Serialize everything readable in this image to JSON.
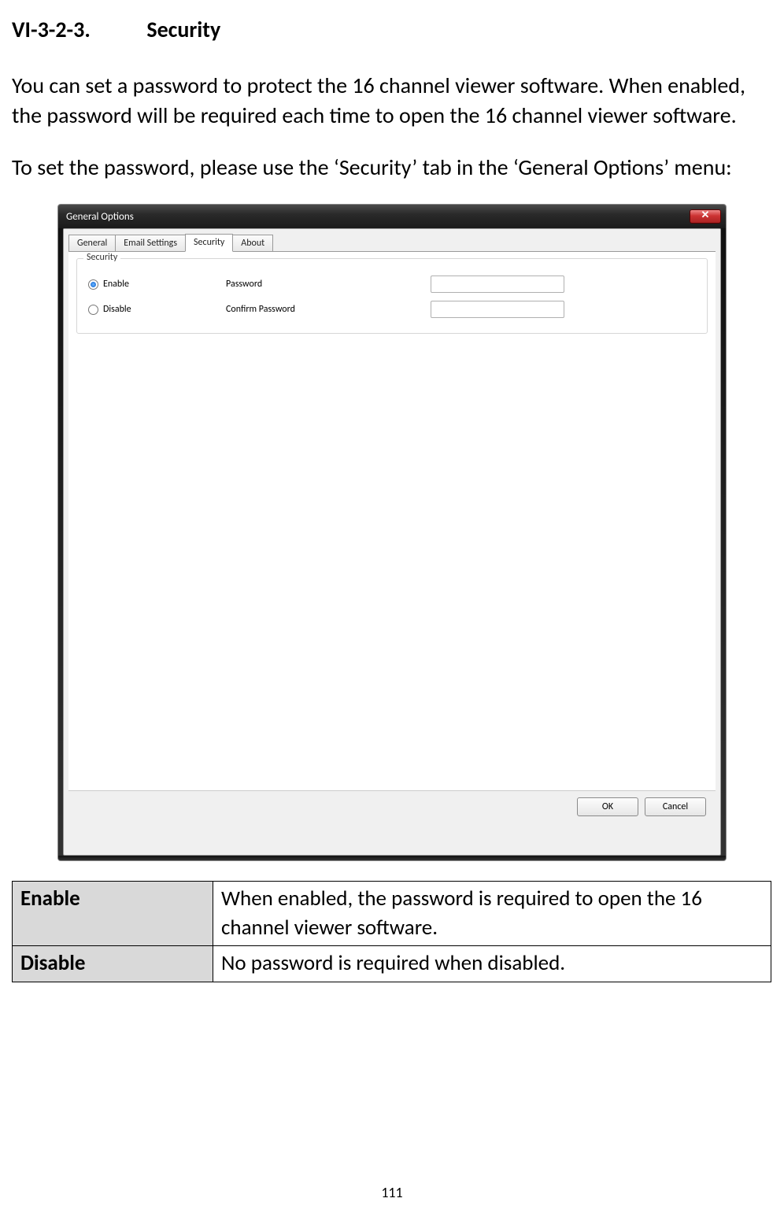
{
  "heading": {
    "number": "VI-3-2-3.",
    "title": "Security"
  },
  "para1": "You can set a password to protect the 16 channel viewer software. When enabled, the password will be required each time to open the 16 channel viewer software.",
  "para2": "To set the password, please use the ‘Security’ tab in the ‘General Options’ menu:",
  "dialog": {
    "title": "General Options",
    "tabs": [
      "General",
      "Email Settings",
      "Security",
      "About"
    ],
    "active_tab": "Security",
    "fieldset_legend": "Security",
    "radio_enable": "Enable",
    "radio_disable": "Disable",
    "label_password": "Password",
    "label_confirm": "Confirm Password",
    "ok": "OK",
    "cancel": "Cancel",
    "close_glyph": "✕"
  },
  "table": {
    "rows": [
      {
        "name": "Enable",
        "desc": "When enabled, the password is required to open the 16 channel viewer software."
      },
      {
        "name": "Disable",
        "desc": "No password is required when disabled."
      }
    ]
  },
  "page_number": "111"
}
